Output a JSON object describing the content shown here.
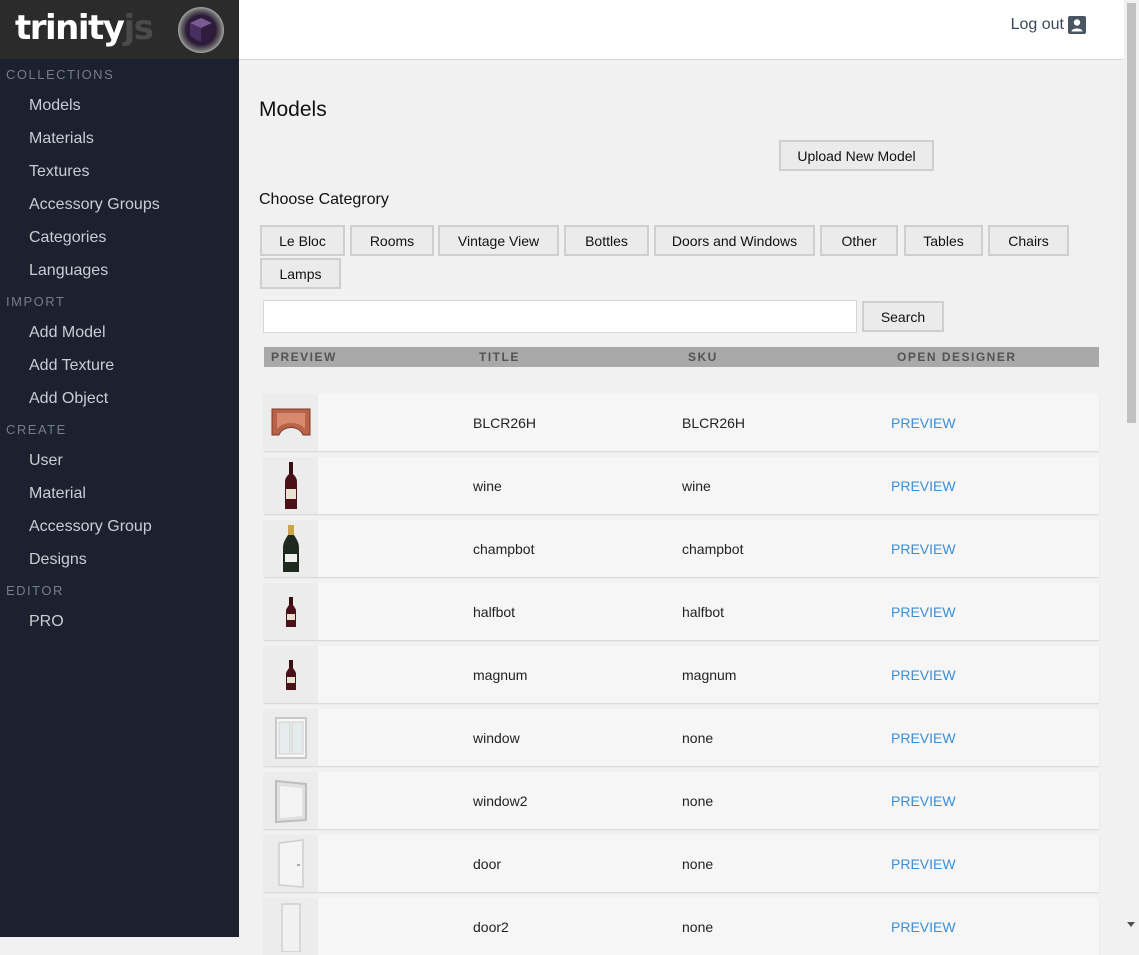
{
  "app": {
    "logo_word1": "trinity",
    "logo_word2": "js"
  },
  "sidebar": {
    "sections": [
      {
        "title": "COLLECTIONS",
        "items": [
          "Models",
          "Materials",
          "Textures",
          "Accessory Groups",
          "Categories",
          "Languages"
        ]
      },
      {
        "title": "IMPORT",
        "items": [
          "Add Model",
          "Add Texture",
          "Add Object"
        ]
      },
      {
        "title": "CREATE",
        "items": [
          "User",
          "Material",
          "Accessory Group",
          "Designs"
        ]
      },
      {
        "title": "EDITOR",
        "items": [
          "PRO"
        ]
      }
    ]
  },
  "header": {
    "logout_label": "Log out",
    "logout_icon": "user-icon"
  },
  "main": {
    "title": "Models",
    "upload_button": "Upload New Model",
    "category_heading": "Choose Categrory",
    "categories": [
      "Le Bloc",
      "Rooms",
      "Vintage View",
      "Bottles",
      "Doors and Windows",
      "Other",
      "Tables",
      "Chairs",
      "Lamps"
    ],
    "search": {
      "value": "",
      "placeholder": "",
      "button": "Search"
    },
    "table": {
      "headers": [
        "PREVIEW",
        "TITLE",
        "SKU",
        "OPEN DESIGNER"
      ],
      "rows": [
        {
          "title": "BLCR26H",
          "sku": "BLCR26H",
          "action": "PREVIEW",
          "thumb": "curved-shelf"
        },
        {
          "title": "wine",
          "sku": "wine",
          "action": "PREVIEW",
          "thumb": "wine-bottle"
        },
        {
          "title": "champbot",
          "sku": "champbot",
          "action": "PREVIEW",
          "thumb": "champagne-bottle"
        },
        {
          "title": "halfbot",
          "sku": "halfbot",
          "action": "PREVIEW",
          "thumb": "small-bottle"
        },
        {
          "title": "magnum",
          "sku": "magnum",
          "action": "PREVIEW",
          "thumb": "small-bottle"
        },
        {
          "title": "window",
          "sku": "none",
          "action": "PREVIEW",
          "thumb": "window"
        },
        {
          "title": "window2",
          "sku": "none",
          "action": "PREVIEW",
          "thumb": "window2"
        },
        {
          "title": "door",
          "sku": "none",
          "action": "PREVIEW",
          "thumb": "door"
        },
        {
          "title": "door2",
          "sku": "none",
          "action": "PREVIEW",
          "thumb": "door2"
        }
      ]
    }
  },
  "colors": {
    "sidebar_bg": "#1b212e",
    "link": "#3b8ed6",
    "header_bg": "#a9a9a9"
  }
}
